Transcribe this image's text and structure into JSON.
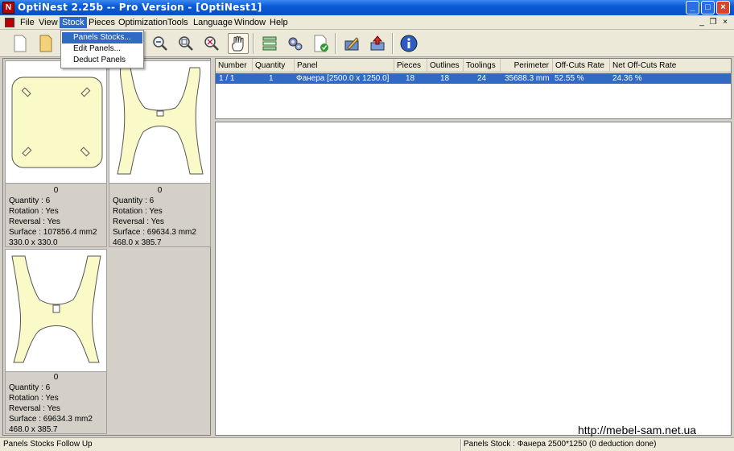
{
  "window": {
    "title": "OptiNest 2.25b -- Pro Version - [OptiNest1]",
    "app_icon_letter": "N"
  },
  "menu": {
    "items": [
      "File",
      "View",
      "Stock",
      "Pieces",
      "Optimization",
      "Tools",
      "Language",
      "Window",
      "Help"
    ],
    "active": "Stock"
  },
  "stock_menu": {
    "items": [
      "Panels Stocks...",
      "Edit Panels...",
      "Deduct Panels"
    ],
    "highlighted": "Panels Stocks..."
  },
  "toolbar": {
    "buttons": [
      "new-icon",
      "open-icon",
      "zoom-out-icon",
      "zoom-fit-icon",
      "zoom-window-icon",
      "pan-hand-icon",
      "nesting-settings-icon",
      "optimize-gears-icon",
      "validate-icon",
      "edit-pencil-icon",
      "export-icon",
      "info-icon"
    ],
    "pressed": "pan-hand-icon"
  },
  "pieces": [
    {
      "index": "0",
      "shape": "rounded-square",
      "lines": [
        "Quantity : 6",
        "Rotation : Yes",
        "Reversal : Yes",
        "Surface : 107856.4 mm2",
        "330.0  x  330.0"
      ]
    },
    {
      "index": "0",
      "shape": "chair-leg",
      "lines": [
        "Quantity : 6",
        "Rotation : Yes",
        "Reversal : Yes",
        "Surface : 69634.3 mm2",
        "468.0  x  385.7"
      ]
    },
    {
      "index": "0",
      "shape": "chair-leg",
      "lines": [
        "Quantity : 6",
        "Rotation : Yes",
        "Reversal : Yes",
        "Surface : 69634.3 mm2",
        "468.0  x  385.7"
      ]
    }
  ],
  "results_table": {
    "columns": [
      "Number",
      "Quantity",
      "Panel",
      "Pieces",
      "Outlines",
      "Toolings",
      "Perimeter",
      "Off-Cuts Rate",
      "Net Off-Cuts Rate"
    ],
    "rows": [
      [
        "1 / 1",
        "1",
        "Фанера [2500.0  x  1250.0]",
        "18",
        "18",
        "24",
        "35688.3 mm",
        "52.55 %",
        "24.36 %"
      ]
    ]
  },
  "status": {
    "left": "Panels Stocks Follow Up",
    "right": "Panels Stock : Фанера 2500*1250 (0 deduction done)"
  },
  "watermark": "http://mebel-sam.net.ua",
  "colors": {
    "selection": "#316ac5",
    "piece_fill": "#fafac8",
    "titlebar": "#0a5ad6"
  }
}
